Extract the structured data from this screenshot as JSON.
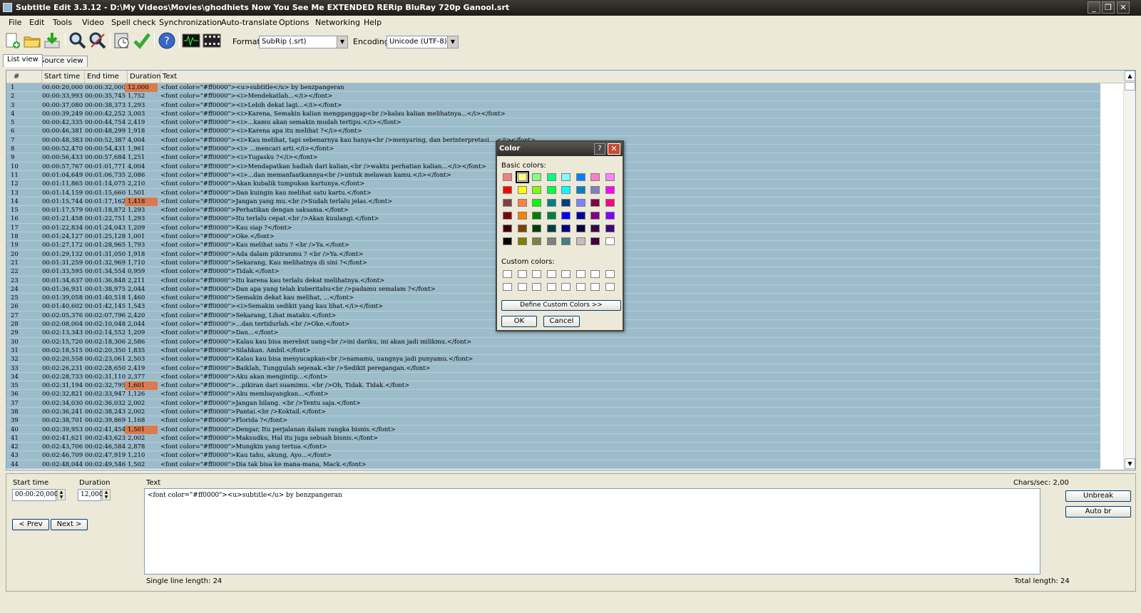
{
  "window": {
    "title": "Subtitle Edit 3.3.12 - D:\\My Videos\\Movies\\ghodhiets Now You See Me EXTENDED RERip BluRay 720p Ganool.srt",
    "min": "_",
    "max": "❐",
    "close": "✕"
  },
  "menu": [
    "File",
    "Edit",
    "Tools",
    "Video",
    "Spell check",
    "Synchronization",
    "Auto-translate",
    "Options",
    "Networking",
    "Help"
  ],
  "toolbar": {
    "format_label": "Format",
    "format_value": "SubRip (.srt)",
    "encoding_label": "Encoding",
    "encoding_value": "Unicode (UTF-8)"
  },
  "tabs": [
    "List view",
    "Source view"
  ],
  "grid": {
    "headers": [
      "#",
      "Start time",
      "End time",
      "Duration",
      "Text"
    ],
    "rows": [
      [
        "1",
        "00:00:20,000",
        "00:00:32,000",
        "12,000",
        "<font color=\"#ff0000\"><u>subtitle</u> by benzpangeran",
        true
      ],
      [
        "2",
        "00:00:33,993",
        "00:00:35,745",
        "1,752",
        "<font color=\"#ff0000\"><i>Mendekatlah...</i></font>",
        false
      ],
      [
        "3",
        "00:00:37,080",
        "00:00:38,373",
        "1,293",
        "<font color=\"#ff0000\"><i>Lebih dekat lagi...</i></font>",
        false
      ],
      [
        "4",
        "00:00:39,249",
        "00:00:42,252",
        "3,003",
        "<font color=\"#ff0000\"><i>Karena, Semakin kalian mengganggap<br />kalau kalian melihatnya...</i></font>",
        false
      ],
      [
        "5",
        "00:00:42,335",
        "00:00:44,754",
        "2,419",
        "<font color=\"#ff0000\"><i>...kamu akan semakin mudah tertipu.</i></font>",
        false
      ],
      [
        "6",
        "00:00:46,381",
        "00:00:48,299",
        "1,918",
        "<font color=\"#ff0000\"><i>Karena apa itu melihat ?</i></font>",
        false
      ],
      [
        "7",
        "00:00:48,383",
        "00:00:52,387",
        "4,004",
        "<font color=\"#ff0000\"><i>Kau melihat, tapi sebenarnya kau hanya<br />menyaring, dan berinterpretasi... </i></font>",
        false
      ],
      [
        "8",
        "00:00:52,470",
        "00:00:54,431",
        "1,961",
        "<font color=\"#ff0000\"><i> ...mencari arti.</i></font>",
        false
      ],
      [
        "9",
        "00:00:56,433",
        "00:00:57,684",
        "1,251",
        "<font color=\"#ff0000\"><i>Tugasku ?</i></font>",
        false
      ],
      [
        "10",
        "00:00:57,767",
        "00:01:01,771",
        "4,004",
        "<font color=\"#ff0000\"><i>Mendapatkan hadiah dari kalian,<br />waktu perhatian kalian...</i></font>",
        false
      ],
      [
        "11",
        "00:01:04,649",
        "00:01:06,735",
        "2,086",
        "<font color=\"#ff0000\"><i>...dan memanfaatkannya<br />untuk melawan kamu.</i></font>",
        false
      ],
      [
        "12",
        "00:01:11,865",
        "00:01:14,075",
        "2,210",
        "<font color=\"#ff0000\">Akan kubalik tumpukan kartunya.</font>",
        false
      ],
      [
        "13",
        "00:01:14,159",
        "00:01:15,660",
        "1,501",
        "<font color=\"#ff0000\">Dan kuingin kau melihat satu kartu.</font>",
        false
      ],
      [
        "14",
        "00:01:15,744",
        "00:01:17,162",
        "1,418",
        "<font color=\"#ff0000\">Jangan yang mu.<br />Sudah terlalu jelas.</font>",
        true
      ],
      [
        "15",
        "00:01:17,579",
        "00:01:18,872",
        "1,293",
        "<font color=\"#ff0000\">Perhatikan dengan saksama.</font>",
        false
      ],
      [
        "16",
        "00:01:21,458",
        "00:01:22,751",
        "1,293",
        "<font color=\"#ff0000\">Itu terlalu cepat.<br />Akan kuulangi.</font>",
        false
      ],
      [
        "17",
        "00:01:22,834",
        "00:01:24,043",
        "1,209",
        "<font color=\"#ff0000\">Kau siap ?</font>",
        false
      ],
      [
        "18",
        "00:01:24,127",
        "00:01:25,128",
        "1,001",
        "<font color=\"#ff0000\">Oke.</font>",
        false
      ],
      [
        "19",
        "00:01:27,172",
        "00:01:28,965",
        "1,793",
        "<font color=\"#ff0000\">Kau melihat satu ? <br />Ya.</font>",
        false
      ],
      [
        "20",
        "00:01:29,132",
        "00:01:31,050",
        "1,918",
        "<font color=\"#ff0000\">Ada dalam pikiranmu ? <br />Ya.</font>",
        false
      ],
      [
        "21",
        "00:01:31,259",
        "00:01:32,969",
        "1,710",
        "<font color=\"#ff0000\">Sekarang, Kau melihatnya di sini ?</font>",
        false
      ],
      [
        "22",
        "00:01:33,595",
        "00:01:34,554",
        "0,959",
        "<font color=\"#ff0000\">Tidak.</font>",
        false
      ],
      [
        "23",
        "00:01:34,637",
        "00:01:36,848",
        "2,211",
        "<font color=\"#ff0000\">Itu karena kau terlalu dekat melihatnya.</font>",
        false
      ],
      [
        "24",
        "00:01:36,931",
        "00:01:38,975",
        "2,044",
        "<font color=\"#ff0000\">Dan apa yang telah kuberitahu<br />padamu semalam ?</font>",
        false
      ],
      [
        "25",
        "00:01:39,058",
        "00:01:40,518",
        "1,460",
        "<font color=\"#ff0000\">Semakin dekat kau melihat, ...</font>",
        false
      ],
      [
        "26",
        "00:01:40,602",
        "00:01:42,145",
        "1,543",
        "<font color=\"#ff0000\"><i>Semakin sedikit yang kau lihat.</i></font>",
        false
      ],
      [
        "27",
        "00:02:05,376",
        "00:02:07,796",
        "2,420",
        "<font color=\"#ff0000\">Sekarang, Lihat mataku.</font>",
        false
      ],
      [
        "28",
        "00:02:08,004",
        "00:02:10,048",
        "2,044",
        "<font color=\"#ff0000\">...dan tertidurlah.<br />Oke.</font>",
        false
      ],
      [
        "29",
        "00:02:13,343",
        "00:02:14,552",
        "1,209",
        "<font color=\"#ff0000\">Dan...</font>",
        false
      ],
      [
        "30",
        "00:02:15,720",
        "00:02:18,306",
        "2,586",
        "<font color=\"#ff0000\">Kalau kau bisa merebut uang<br />ini dariku, ini akan jadi milikmu.</font>",
        false
      ],
      [
        "31",
        "00:02:18,515",
        "00:02:20,350",
        "1,835",
        "<font color=\"#ff0000\">Silahkan. Ambil.</font>",
        false
      ],
      [
        "32",
        "00:02:20,558",
        "00:02:23,061",
        "2,503",
        "<font color=\"#ff0000\">Kalau kau bisa menyucapkan<br />namamu, uangnya jadi punyamu.</font>",
        false
      ],
      [
        "33",
        "00:02:26,231",
        "00:02:28,650",
        "2,419",
        "<font color=\"#ff0000\">Baiklah, Tunggulah sejenak.<br />Sedikit peregangan.</font>",
        false
      ],
      [
        "34",
        "00:02:28,733",
        "00:02:31,110",
        "2,377",
        "<font color=\"#ff0000\">Aku akan mengintip...</font>",
        false
      ],
      [
        "35",
        "00:02:31,194",
        "00:02:32,795",
        "1,601",
        "<font color=\"#ff0000\">...pikiran dari suamimu. <br />Oh, Tidak. Tidak.</font>",
        true
      ],
      [
        "36",
        "00:02:32,821",
        "00:02:33,947",
        "1,126",
        "<font color=\"#ff0000\">Aku membayangkan...</font>",
        false
      ],
      [
        "37",
        "00:02:34,030",
        "00:02:36,032",
        "2,002",
        "<font color=\"#ff0000\">Jangan bilang. <br />Tentu saja.</font>",
        false
      ],
      [
        "38",
        "00:02:36,241",
        "00:02:38,243",
        "2,002",
        "<font color=\"#ff0000\">Pantai.<br />Koktail.</font>",
        false
      ],
      [
        "39",
        "00:02:38,701",
        "00:02:39,869",
        "1,168",
        "<font color=\"#ff0000\">Florida ?</font>",
        false
      ],
      [
        "40",
        "00:02:39,953",
        "00:02:41,454",
        "1,501",
        "<font color=\"#ff0000\">Dengar, Itu perjalanan dalam rangka bisnis.</font>",
        true
      ],
      [
        "41",
        "00:02:41,621",
        "00:02:43,623",
        "2,002",
        "<font color=\"#ff0000\">Maksudku, Hal itu juga sebuah bisnis.</font>",
        false
      ],
      [
        "42",
        "00:02:43,706",
        "00:02:46,584",
        "2,878",
        "<font color=\"#ff0000\">Mungkin yang tertua.</font>",
        false
      ],
      [
        "43",
        "00:02:46,709",
        "00:02:47,919",
        "1,210",
        "<font color=\"#ff0000\">Kau tahu, akung, Ayo...</font>",
        false
      ],
      [
        "44",
        "00:02:48,044",
        "00:02:49,546",
        "1,502",
        "<font color=\"#ff0000\">Dia tak bisa ke mana-mana, Mack.</font>",
        false
      ]
    ]
  },
  "editor": {
    "start_label": "Start time",
    "start_value": "00:00:20,000",
    "duration_label": "Duration",
    "duration_value": "12,000",
    "text_label": "Text",
    "text_value": "<font color=\"#ff0000\"><u>subtitle</u> by benzpangeran",
    "chars_sec": "Chars/sec: 2,00",
    "single_line": "Single line length: 24",
    "total_length": "Total length: 24",
    "prev": "< Prev",
    "next": "Next >",
    "unbreak": "Unbreak",
    "auto_br": "Auto br"
  },
  "color_dialog": {
    "title": "Color",
    "help": "?",
    "close": "✕",
    "basic_label": "Basic colors:",
    "custom_label": "Custom colors:",
    "define_btn": "Define Custom Colors >>",
    "ok": "OK",
    "cancel": "Cancel",
    "basic_colors": [
      "#f08080",
      "#ffff80",
      "#80ff80",
      "#00ff80",
      "#80ffff",
      "#0080ff",
      "#ff80c0",
      "#ff80ff",
      "#ff0000",
      "#ffff00",
      "#80ff00",
      "#00ff40",
      "#00ffff",
      "#0080c0",
      "#8080c0",
      "#ff00ff",
      "#804040",
      "#ff8040",
      "#00ff00",
      "#008080",
      "#004080",
      "#8080ff",
      "#800040",
      "#ff0080",
      "#800000",
      "#ff8000",
      "#008000",
      "#008040",
      "#0000ff",
      "#0000a0",
      "#800080",
      "#8000ff",
      "#400000",
      "#804000",
      "#004000",
      "#004040",
      "#000080",
      "#000040",
      "#400040",
      "#400080",
      "#000000",
      "#808000",
      "#808040",
      "#808080",
      "#408080",
      "#c0c0c0",
      "#400040",
      "#ffffff"
    ],
    "selected_index": 1
  }
}
